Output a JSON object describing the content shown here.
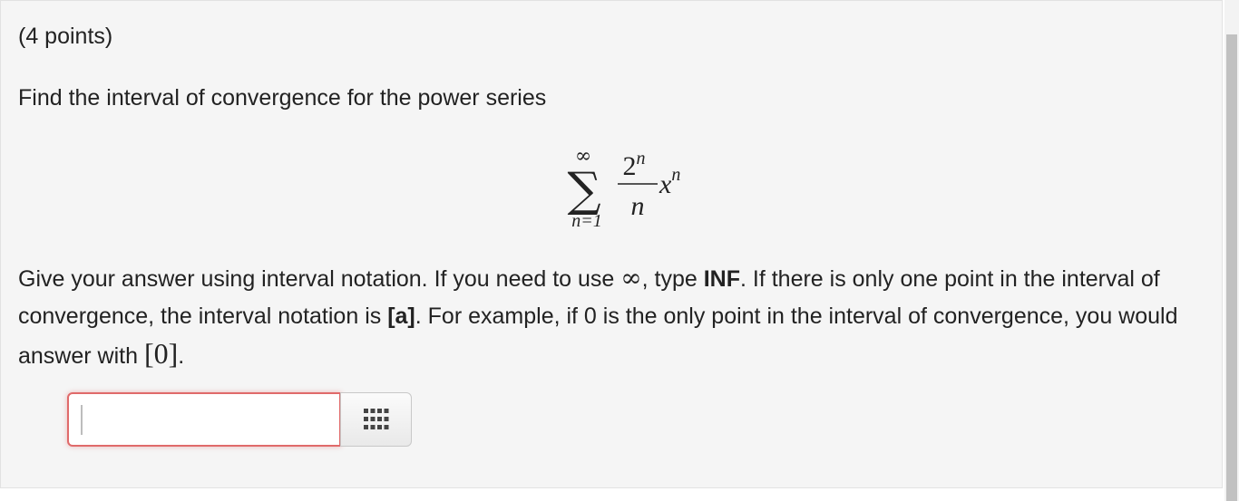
{
  "question": {
    "points": "(4 points)",
    "prompt": "Find the interval of convergence for the power series",
    "formula": {
      "sum_upper": "∞",
      "sum_lower": "n=1",
      "numerator": "2",
      "numerator_exp": "n",
      "denominator": "n",
      "variable": "x",
      "variable_exp": "n"
    },
    "instructions": {
      "part1": "Give your answer using interval notation. If you need to use ",
      "infinity_symbol": "∞",
      "part2": ", type ",
      "inf_keyword": "INF",
      "part3": ". If there is only one point in the interval of convergence, the interval notation is ",
      "single_point_notation": "[a]",
      "part4": ". For example, if 0 is the only point in the interval of convergence, you would answer with ",
      "example_answer": "[0]",
      "part5": "."
    }
  },
  "answer": {
    "value": "",
    "placeholder": ""
  },
  "icons": {
    "palette": "grid-icon"
  },
  "colors": {
    "panel_bg": "#f5f5f5",
    "input_error_border": "#e06a6a"
  }
}
